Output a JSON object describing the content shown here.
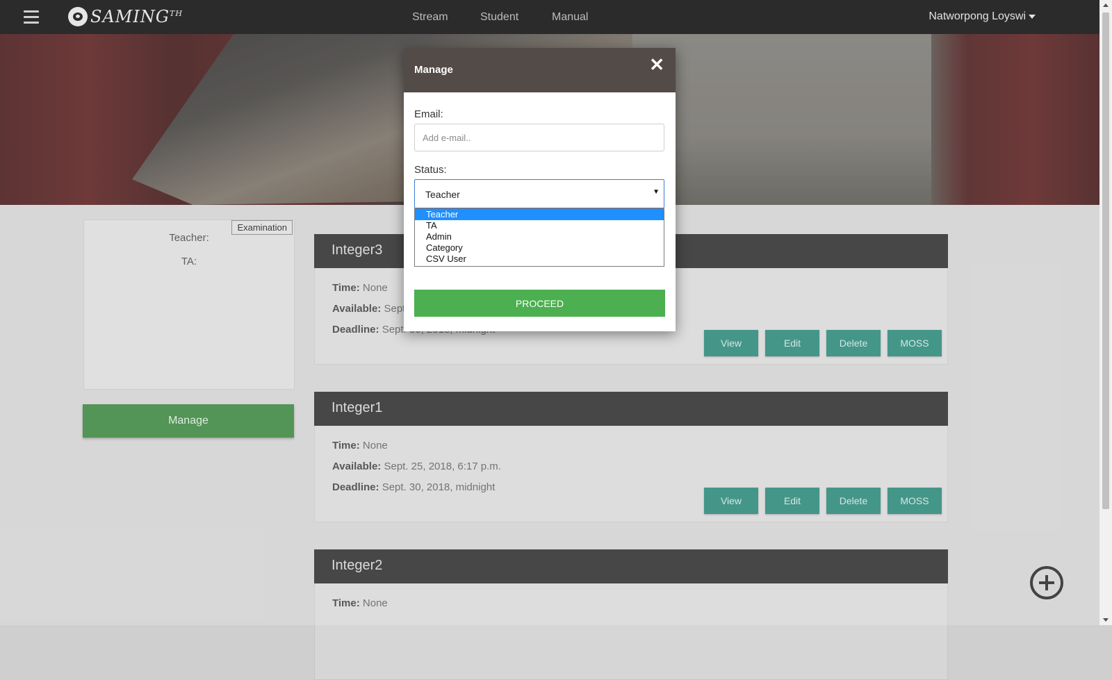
{
  "header": {
    "logo_text": "SAMING",
    "logo_suffix": "TH",
    "nav": [
      "Stream",
      "Student",
      "Manual"
    ],
    "user_name": "Natworpong Loyswi"
  },
  "sidebar": {
    "badge": "Examination",
    "teacher_label": "Teacher:",
    "ta_label": "TA:",
    "manage_button": "Manage"
  },
  "exams": [
    {
      "title": "Integer3",
      "time_label": "Time:",
      "time_value": "None",
      "available_label": "Available:",
      "available_value": "Sept. 25, 2018, 6:17 p.m.",
      "deadline_label": "Deadline:",
      "deadline_value": "Sept. 30, 2018, midnight"
    },
    {
      "title": "Integer1",
      "time_label": "Time:",
      "time_value": "None",
      "available_label": "Available:",
      "available_value": "Sept. 25, 2018, 6:17 p.m.",
      "deadline_label": "Deadline:",
      "deadline_value": "Sept. 30, 2018, midnight"
    },
    {
      "title": "Integer2",
      "time_label": "Time:",
      "time_value": "None"
    }
  ],
  "exam_buttons": [
    "View",
    "Edit",
    "Delete",
    "MOSS"
  ],
  "modal": {
    "title": "Manage",
    "close_symbol": "✕",
    "email_label": "Email:",
    "email_placeholder": "Add e-mail..",
    "email_value": "",
    "status_label": "Status:",
    "status_selected": "Teacher",
    "status_options": [
      "Teacher",
      "TA",
      "Admin",
      "Category",
      "CSV User"
    ],
    "proceed_button": "PROCEED"
  },
  "colors": {
    "nav_bg": "#2b2b2b",
    "modal_header": "#524b48",
    "proceed_green": "#4caf50",
    "manage_green": "#2e7d32",
    "teal_button": "#1b7f6f",
    "dropdown_highlight": "#1e90ff"
  },
  "icons": [
    "hamburger-icon",
    "logo-icon",
    "caret-down-icon",
    "close-icon",
    "add-circle-icon"
  ]
}
